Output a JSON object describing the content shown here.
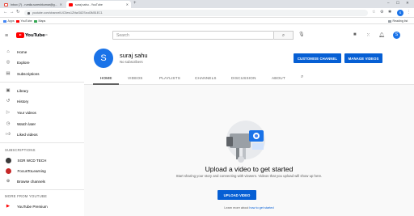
{
  "browser": {
    "tabs": [
      {
        "title": "Inbox (7) - rumila.sureshkumar@g...",
        "icon": "gmail-icon",
        "active": false
      },
      {
        "title": "suraj sahu - YouTube",
        "icon": "youtube-icon",
        "active": true
      }
    ],
    "new_tab": "+",
    "url": "youtube.com/channel/UC5ew1ZNwG8ZSrcd3M51EC1",
    "bookmarks": [
      "Apps",
      "YouTube",
      "Maps"
    ],
    "reading_list": "Reading list",
    "profile_initial": "S",
    "colors": {
      "tabbar": "#dee1e6",
      "youtube_red": "#ff0000"
    }
  },
  "masthead": {
    "logo_text": "YouTube",
    "logo_sup": "IN",
    "search_placeholder": "Search",
    "avatar_initial": "S"
  },
  "sidebar": {
    "main": [
      {
        "label": "Home",
        "icon": "home-icon"
      },
      {
        "label": "Explore",
        "icon": "compass-icon"
      },
      {
        "label": "Subscriptions",
        "icon": "subscriptions-icon"
      }
    ],
    "library": [
      {
        "label": "Library",
        "icon": "library-icon"
      },
      {
        "label": "History",
        "icon": "history-icon"
      },
      {
        "label": "Your videos",
        "icon": "play-square-icon"
      },
      {
        "label": "Watch later",
        "icon": "clock-icon"
      },
      {
        "label": "Liked videos",
        "icon": "thumbs-up-icon"
      }
    ],
    "subscriptions_heading": "SUBSCRIPTIONS",
    "subscriptions": [
      {
        "label": "SGR WCD TECH",
        "color": "#3b3b3b"
      },
      {
        "label": "FocusToLearning",
        "color": "#c62828"
      },
      {
        "label": "Browse channels",
        "icon": "add-circle-icon"
      }
    ],
    "more_heading": "MORE FROM YOUTUBE",
    "more": [
      {
        "label": "YouTube Premium",
        "icon": "youtube-icon"
      }
    ]
  },
  "channel": {
    "avatar_initial": "S",
    "name": "suraj sahu",
    "subscribers": "No subscribers",
    "customise_button": "CUSTOMISE CHANNEL",
    "manage_button": "MANAGE VIDEOS",
    "tabs": [
      "HOME",
      "VIDEOS",
      "PLAYLISTS",
      "CHANNELS",
      "DISCUSSION",
      "ABOUT"
    ],
    "active_tab": "HOME",
    "accent": "#065fd4"
  },
  "empty_state": {
    "title": "Upload a video to get started",
    "description": "Start sharing your story and connecting with viewers. Videos that you upload will show up here.",
    "upload_button": "UPLOAD VIDEO",
    "learn_prefix": "Learn more about ",
    "learn_link": "how to get started"
  }
}
